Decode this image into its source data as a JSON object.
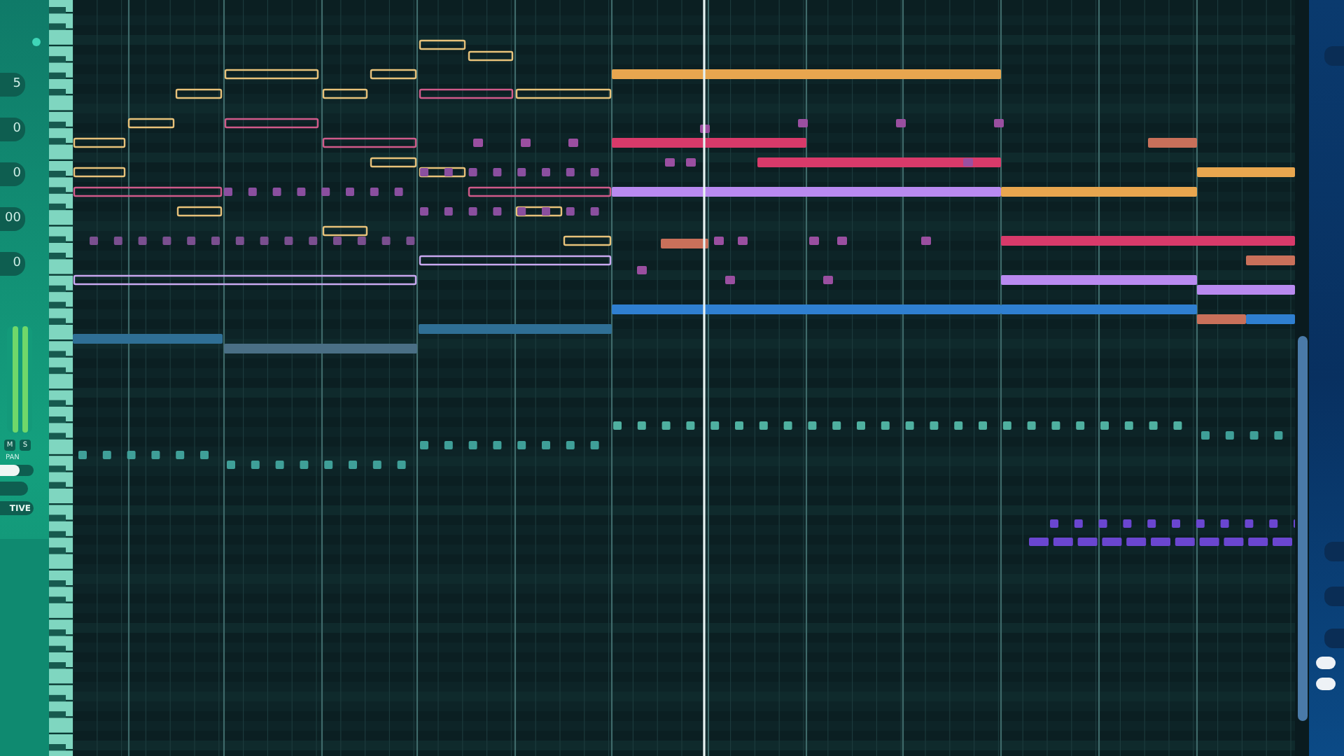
{
  "track_panel": {
    "fields": [
      {
        "value": "5"
      },
      {
        "value": "0"
      },
      {
        "value": "0"
      },
      {
        "value": "00"
      },
      {
        "value": "0"
      }
    ],
    "mute_button": "M",
    "solo_button": "S",
    "pan_label": "PAN",
    "pan": {
      "level": 0.6
    },
    "mode_button": "TIVE"
  }
}
